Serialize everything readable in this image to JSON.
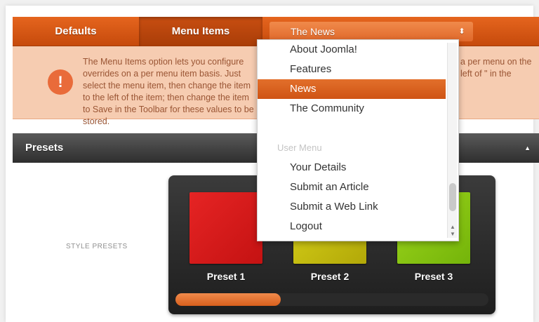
{
  "tabs": {
    "defaults": "Defaults",
    "menu_items": "Menu Items"
  },
  "menu_select": {
    "selected": "The News",
    "arrow": "⬍"
  },
  "notice": {
    "icon": "!",
    "text_left": "The Menu Items option lets you configure overrides on a per menu item basis. Just select the menu item, then change the item to the left of the item; then change the item to Save in the Toolbar for these values to be stored.",
    "text_right": "a per menu on the left of \" in the"
  },
  "presets": {
    "title": "Presets",
    "collapse_icon": "▲",
    "style_label": "STYLE PRESETS",
    "items": [
      {
        "label": "Preset 1",
        "color": "#d81a1a"
      },
      {
        "label": "Preset 2",
        "color": "#c8c012"
      },
      {
        "label": "Preset 3",
        "color": "#8ac813"
      }
    ]
  },
  "dropdown": {
    "items_main": [
      "About Joomla!",
      "Features",
      "News",
      "The Community"
    ],
    "active_item": "News",
    "group_label": "User Menu",
    "items_user": [
      "Your Details",
      "Submit an Article",
      "Submit a Web Link",
      "Logout"
    ]
  },
  "colors": {
    "accent": "#d9591a",
    "notice_bg": "#f6ccb1",
    "dark_bar": "#3a3a3a"
  }
}
